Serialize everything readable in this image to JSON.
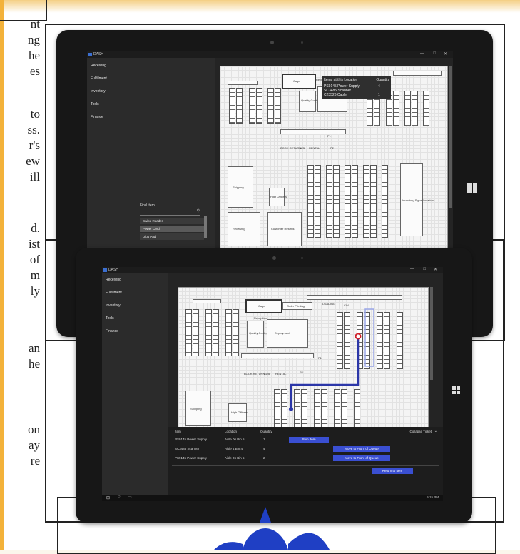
{
  "background_text": {
    "lines": [
      "nt",
      "ng",
      "he",
      "es",
      "to",
      "ss.",
      "r's",
      "ew",
      "ill",
      "d.",
      "ist",
      "of",
      "m",
      "ly",
      "an",
      "he",
      "on",
      "ay",
      "re"
    ]
  },
  "colors": {
    "accent": "#3a4fd2",
    "route": "#2b36a8",
    "highlight_red": "#d0202a",
    "logo_blue": "#1f3fc4"
  },
  "app": {
    "title": "DASH",
    "window_controls": [
      "—",
      "□",
      "✕"
    ],
    "nav": [
      "Receiving",
      "Fulfillment",
      "Inventory",
      "Tools",
      "Finance"
    ]
  },
  "top_screen": {
    "find": {
      "heading": "Find Item",
      "results": [
        "Swipe Reader",
        "Power Cord",
        "Digit Pad"
      ],
      "selected": "Power Cord",
      "search_icon": "search-icon"
    },
    "tooltip": {
      "header_item": "Items at this Location",
      "header_qty": "Quantity",
      "rows": [
        {
          "item": "PS9145 Power Supply",
          "qty": "4"
        },
        {
          "item": "SC3485 Scanner",
          "qty": "1"
        },
        {
          "item": "C23526 Cable",
          "qty": "1"
        }
      ]
    },
    "map_labels": {
      "cage": "Cage",
      "reception": "Reception",
      "quality": "Quality Control",
      "shipping": "Shipping",
      "high_officers": "High Officers",
      "receiving": "Receiving",
      "customer": "Customer Returns",
      "rma": "RMA Receiving",
      "inventory": "Inventory Signs Location",
      "p1": "P1",
      "p2": "P2",
      "ws": "WS",
      "sub": "SUB",
      "rental": "RENTAL",
      "book": "BOOK RETURN"
    }
  },
  "bottom_screen": {
    "map_labels": {
      "cage": "Cage",
      "order_printing": "Order Printing",
      "reception": "Reception",
      "quality": "Quality Control",
      "deployment": "Deployment",
      "shipping": "Shipping",
      "high_officers": "High Officers",
      "cw": "CW",
      "p1": "P1",
      "p2": "P2",
      "ws": "WS",
      "sub": "SUB",
      "rental": "RENTAL",
      "book": "BOOK RETURN",
      "loading": "LOADING"
    },
    "queue": {
      "headers": {
        "item": "Item",
        "location": "Location",
        "quantity": "Quantity",
        "collapse": "Collapse Ticket"
      },
      "rows": [
        {
          "item": "PS9145 Power Supply",
          "location": "Aisle 06 Bin 5",
          "qty": "1",
          "action": "Ship Item"
        },
        {
          "item": "SC3485 Scanner",
          "location": "Aisle 4  Bin 4",
          "qty": "4",
          "action": "Move to Front of Queue"
        },
        {
          "item": "PS9145 Power Supply",
          "location": "Aisle 06 Bin 5",
          "qty": "2",
          "action": "Move to Front of Queue"
        }
      ],
      "return_button": "Return to Item"
    },
    "clock": "5:15 PM"
  }
}
